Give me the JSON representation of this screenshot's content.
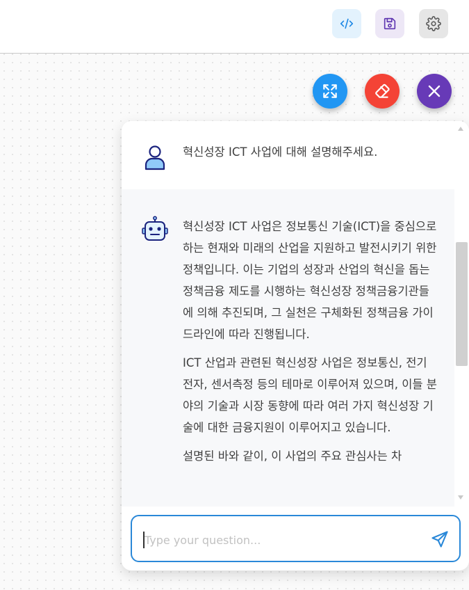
{
  "toolbar": {
    "buttons": [
      {
        "icon": "code-icon",
        "color": "#1e88e5"
      },
      {
        "icon": "save-icon",
        "color": "#5e35b1"
      },
      {
        "icon": "gear-icon",
        "color": "#555555"
      }
    ]
  },
  "fabs": [
    {
      "icon": "expand-icon",
      "color": "#2196f3"
    },
    {
      "icon": "eraser-icon",
      "color": "#f44336"
    },
    {
      "icon": "close-icon",
      "color": "#673ab7"
    }
  ],
  "chat": {
    "user_message": "혁신성장 ICT 사업에 대해 설명해주세요.",
    "bot_paragraphs": [
      "혁신성장 ICT 사업은 정보통신 기술(ICT)을 중심으로 하는 현재와 미래의 산업을 지원하고 발전시키기 위한 정책입니다. 이는 기업의 성장과 산업의 혁신을 돕는 정책금융 제도를 시행하는 혁신성장 정책금융기관들에 의해 추진되며, 그 실천은 구체화된 정책금융 가이드라인에 따라 진행됩니다.",
      "ICT 산업과 관련된 혁신성장 사업은 정보통신, 전기전자, 센서측정 등의 테마로 이루어져 있으며, 이들 분야의 기술과 시장 동향에 따라 여러 가지 혁신성장 기술에 대한 금융지원이 이루어지고 있습니다.",
      "설명된 바와 같이, 이 사업의 주요 관심사는 차"
    ],
    "input_placeholder": "Type your question...",
    "input_value": ""
  },
  "colors": {
    "input_border": "#2a88d8",
    "send_icon": "#2a88d8",
    "avatar_outline": "#1a237e",
    "avatar_fill": "#90caf9"
  }
}
